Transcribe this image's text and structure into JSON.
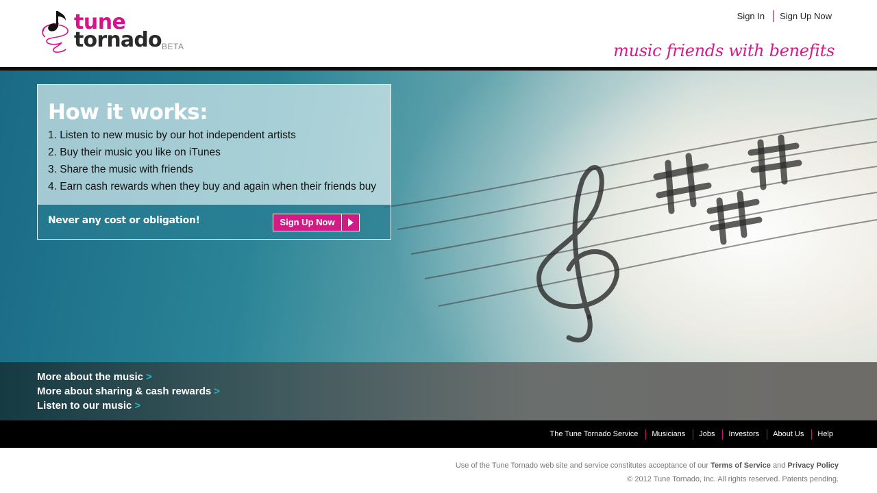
{
  "header": {
    "logo": {
      "word1": "tune",
      "word2": "tornado",
      "badge": "BETA"
    },
    "top_links": {
      "sign_in": "Sign In",
      "sign_up": "Sign Up Now"
    },
    "tagline": "music friends with benefits"
  },
  "how_it_works": {
    "title": "How it works:",
    "steps": [
      "1. Listen to new music by our hot independent artists",
      "2. Buy their music you like on iTunes",
      "3. Share the music with friends",
      "4. Earn cash rewards when they buy and again when their friends buy"
    ],
    "tagline": "Never any cost or obligation!",
    "button_label": "Sign Up Now"
  },
  "more_links": [
    "More about the music",
    "More about sharing & cash rewards",
    "Listen to our music"
  ],
  "more_chevron": ">",
  "footer_nav": [
    "The Tune Tornado Service",
    "Musicians",
    "Jobs",
    "Investors",
    "About Us",
    "Help"
  ],
  "legal": {
    "prefix": "Use of the Tune Tornado web site and service constitutes acceptance of our",
    "terms": "Terms of Service",
    "and": "and",
    "privacy": "Privacy Policy",
    "copyright": "© 2012 Tune Tornado, Inc. All rights reserved. Patents pending."
  },
  "colors": {
    "brand_pink": "#d4148c",
    "accent_teal": "#22b4c4",
    "header_bar": "#0c0c0c"
  }
}
